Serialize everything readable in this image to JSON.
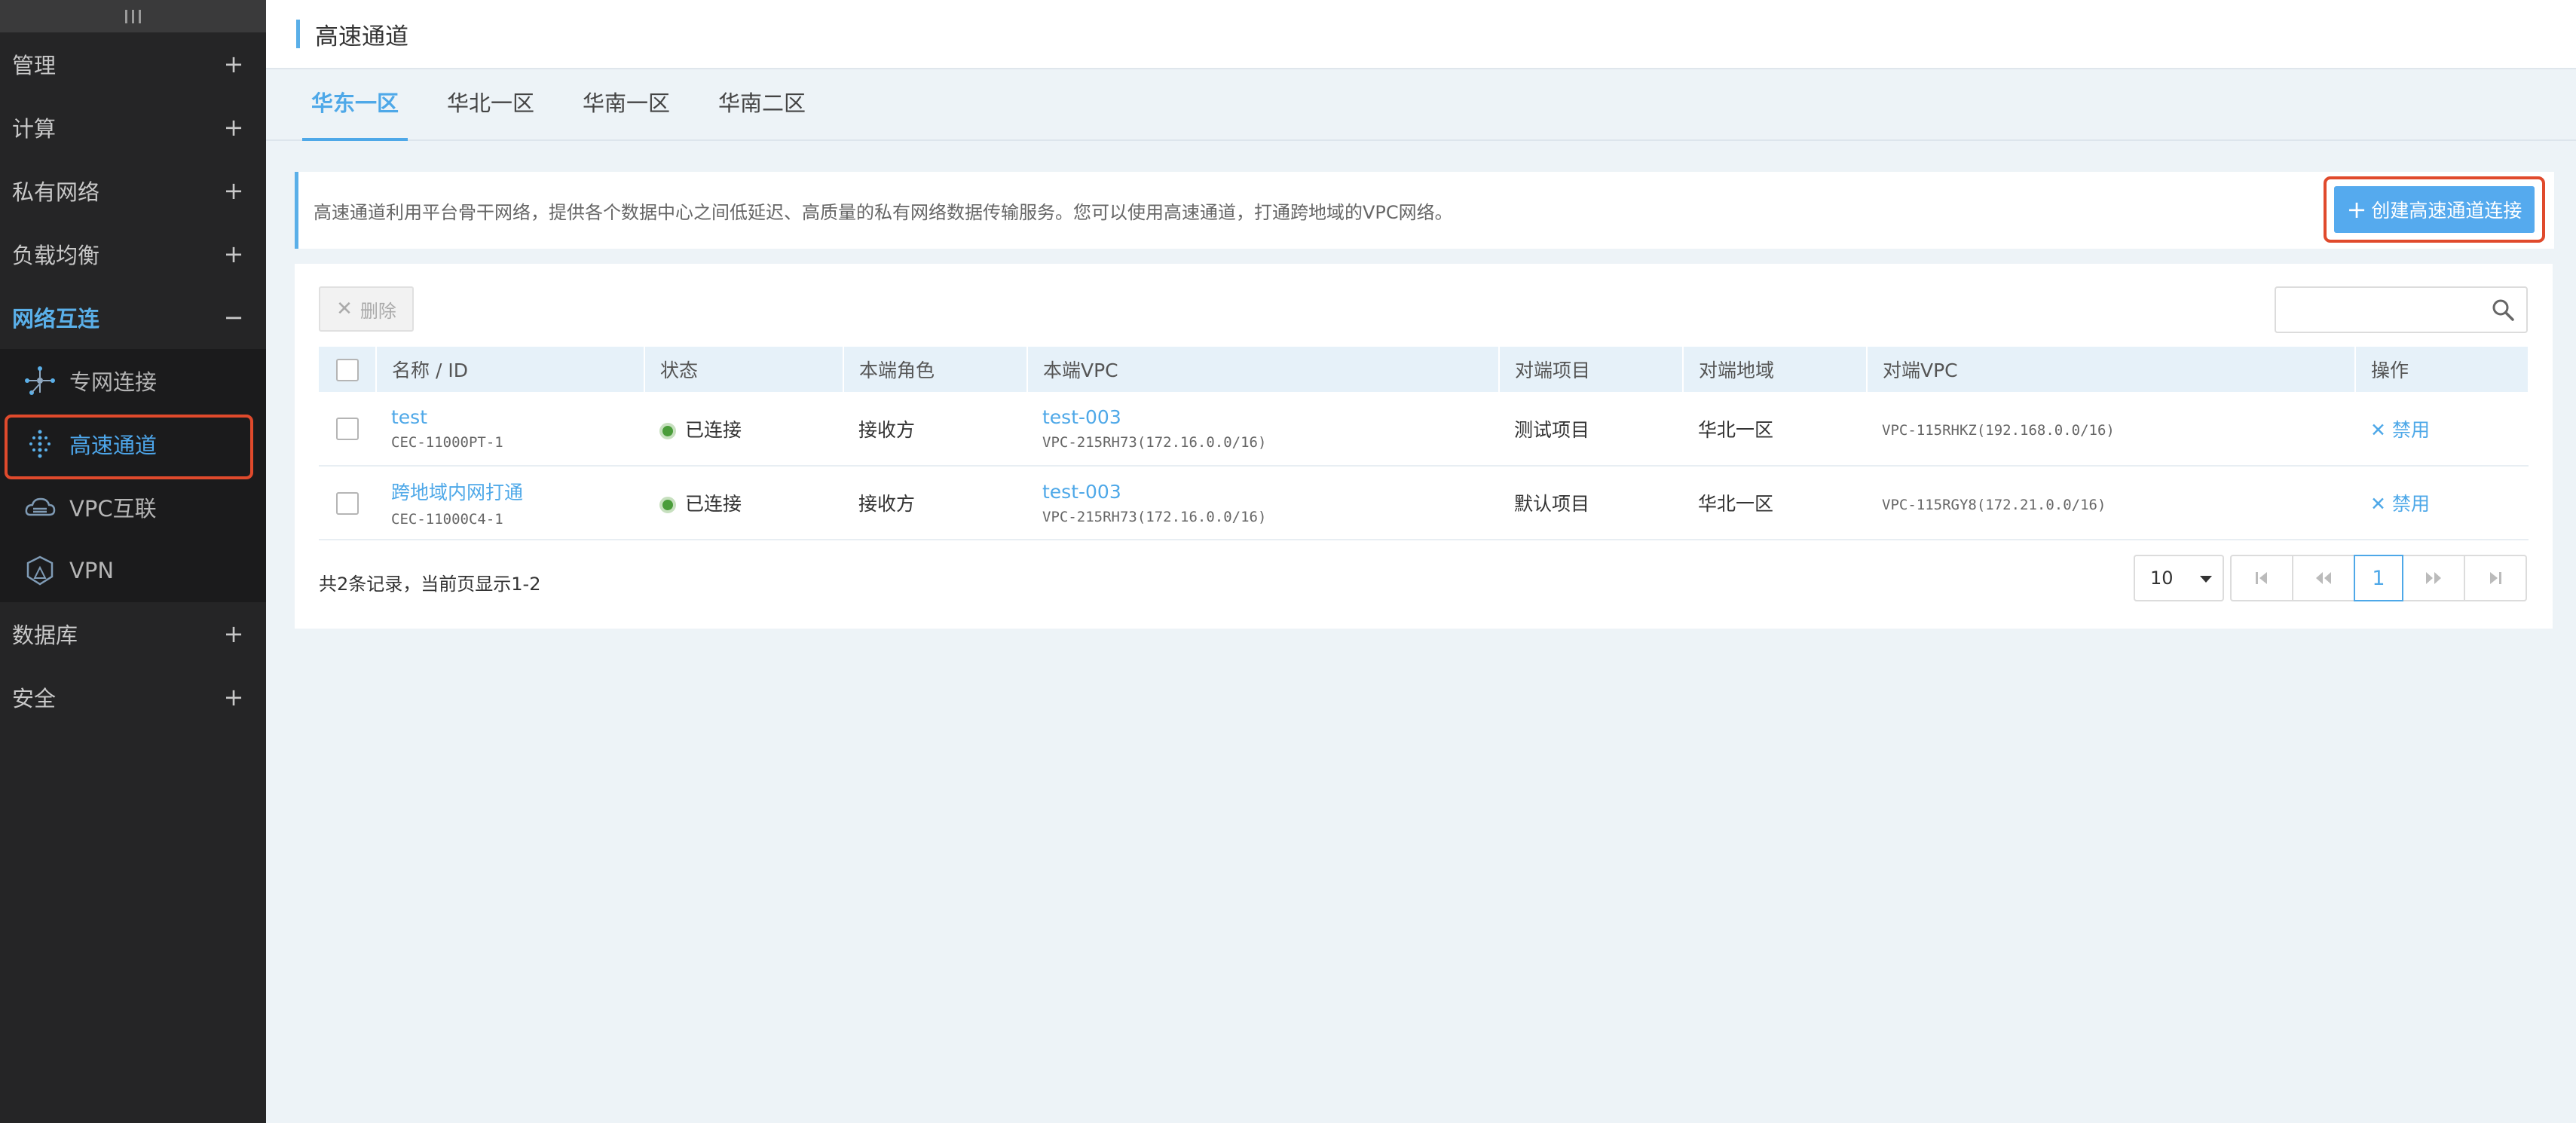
{
  "sidebar": {
    "menu": [
      {
        "label": "管理",
        "sign": "+"
      },
      {
        "label": "计算",
        "sign": "+"
      },
      {
        "label": "私有网络",
        "sign": "+"
      },
      {
        "label": "负载均衡",
        "sign": "+"
      },
      {
        "label": "网络互连",
        "sign": "−"
      }
    ],
    "submenu": [
      {
        "label": "专网连接",
        "icon": "network-node-icon"
      },
      {
        "label": "高速通道",
        "icon": "express-channel-icon",
        "active": true
      },
      {
        "label": "VPC互联",
        "icon": "cloud-link-icon"
      },
      {
        "label": "VPN",
        "icon": "shield-icon"
      }
    ],
    "menu_after": [
      {
        "label": "数据库",
        "sign": "+"
      },
      {
        "label": "安全",
        "sign": "+"
      }
    ]
  },
  "header": {
    "title": "高速通道"
  },
  "tabs": [
    {
      "label": "华东一区",
      "active": true
    },
    {
      "label": "华北一区"
    },
    {
      "label": "华南一区"
    },
    {
      "label": "华南二区"
    }
  ],
  "notice": {
    "text": "高速通道利用平台骨干网络，提供各个数据中心之间低延迟、高质量的私有网络数据传输服务。您可以使用高速通道，打通跨地域的VPC网络。",
    "create_button": "创建高速通道连接"
  },
  "toolbar": {
    "delete_label": "删除",
    "search_placeholder": ""
  },
  "table": {
    "columns": [
      "名称 / ID",
      "状态",
      "本端角色",
      "本端VPC",
      "对端项目",
      "对端地域",
      "对端VPC",
      "操作"
    ],
    "rows": [
      {
        "name": "test",
        "id": "CEC-11000PT-1",
        "status": "已连接",
        "role": "接收方",
        "local_vpc_name": "test-003",
        "local_vpc_id": "VPC-215RH73(172.16.0.0/16)",
        "peer_project": "测试项目",
        "peer_region": "华北一区",
        "peer_vpc": "VPC-115RHKZ(192.168.0.0/16)",
        "action": "禁用"
      },
      {
        "name": "跨地域内网打通",
        "id": "CEC-11000C4-1",
        "status": "已连接",
        "role": "接收方",
        "local_vpc_name": "test-003",
        "local_vpc_id": "VPC-215RH73(172.16.0.0/16)",
        "peer_project": "默认项目",
        "peer_region": "华北一区",
        "peer_vpc": "VPC-115RGY8(172.21.0.0/16)",
        "action": "禁用"
      }
    ]
  },
  "pagination": {
    "summary": "共2条记录，当前页显示1-2",
    "page_size": "10",
    "current_page": "1"
  },
  "colors": {
    "accent": "#4ea8e8",
    "sidebar_bg": "#252526",
    "highlight_border": "#e04a2c",
    "status_connected": "#4a9d3a"
  }
}
